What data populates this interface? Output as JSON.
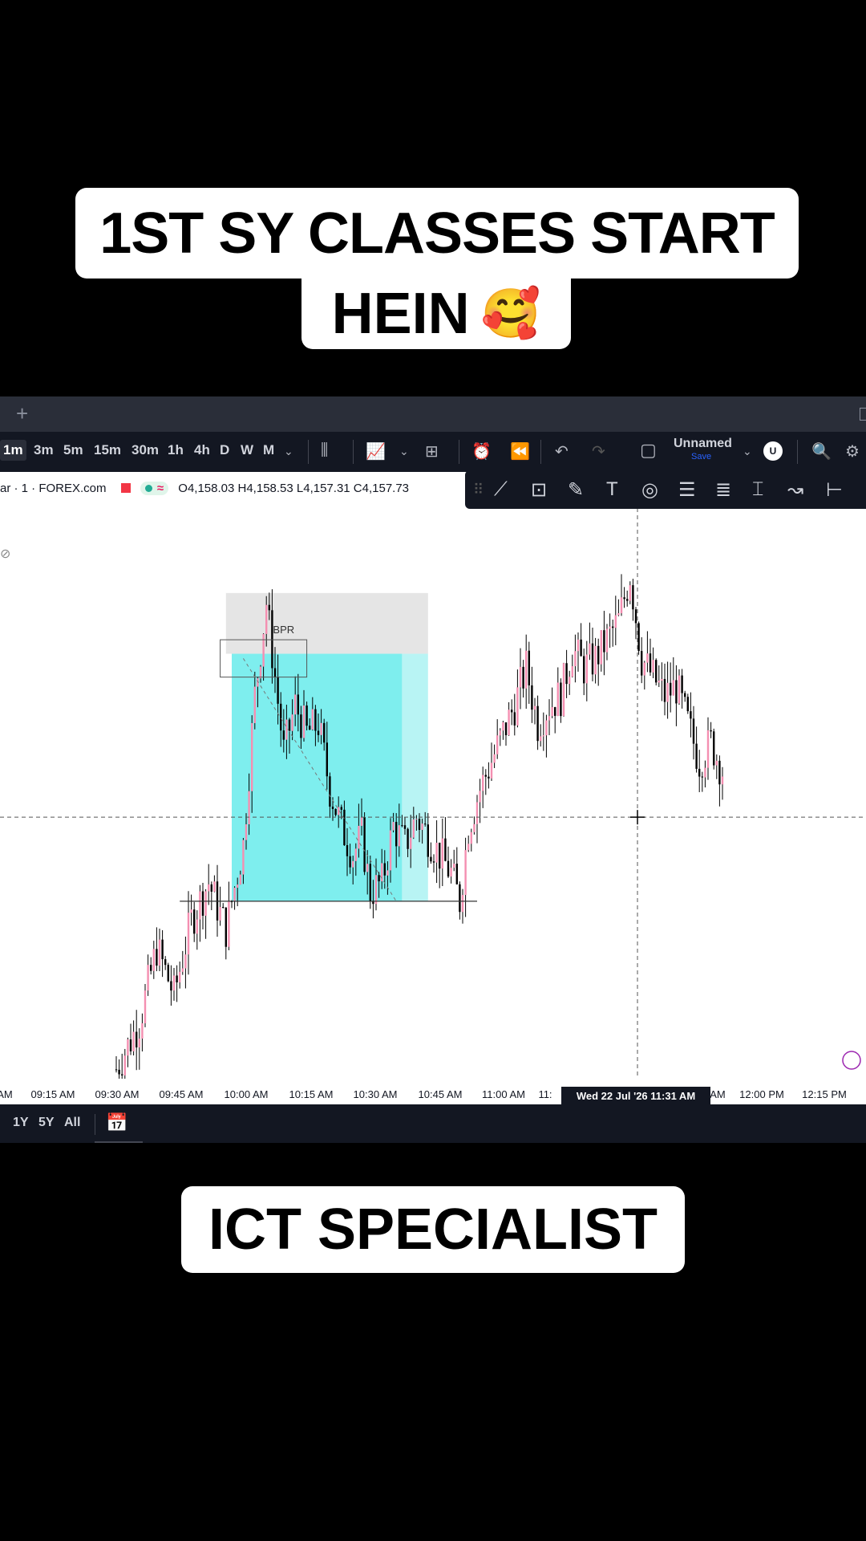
{
  "captions": {
    "top_line1": "1ST SY CLASSES START",
    "top_line2": "HEIN",
    "top_emoji": "🥰",
    "bottom": "ICT SPECIALIST"
  },
  "tabbar": {
    "new_tab": "+"
  },
  "toolbar": {
    "timeframes": [
      "1m",
      "3m",
      "5m",
      "15m",
      "30m",
      "1h",
      "4h",
      "D",
      "W",
      "M"
    ],
    "active_timeframe": "1m",
    "layout_name": "Unnamed",
    "save_label": "Save",
    "avatar": "U"
  },
  "legend": {
    "symbol": "ar · 1 · FOREX.com",
    "wave": "≈",
    "ohlc": "O4,158.03  H4,158.53  L4,157.31  C4,157.73"
  },
  "bottombar": {
    "ranges": [
      "1Y",
      "5Y",
      "All"
    ]
  },
  "colors": {
    "up_candle": "#f48fb1",
    "down_candle": "#000000",
    "box_fill": "#7eeeee",
    "box_light": "#b8f4f4",
    "premium_zone": "#e5e5e5",
    "toolbar_bg": "#131722"
  },
  "chart_data": {
    "type": "candlestick",
    "x_tick_labels": [
      "AM",
      "09:15 AM",
      "09:30 AM",
      "09:45 AM",
      "10:00 AM",
      "10:15 AM",
      "10:30 AM",
      "10:45 AM",
      "11:00 AM",
      "11:",
      "AM",
      "12:00 PM",
      "12:15 PM"
    ],
    "crosshair_label": "Wed 22 Jul '26   11:31 AM",
    "annotations": [
      "BPR"
    ],
    "close_path": [
      [
        0,
        4154.6
      ],
      [
        8,
        4155.1
      ],
      [
        14,
        4155.9
      ],
      [
        20,
        4155.4
      ],
      [
        26,
        4156.2
      ],
      [
        32,
        4156.6
      ],
      [
        38,
        4156.1
      ],
      [
        44,
        4157.0
      ],
      [
        48,
        4158.6
      ],
      [
        52,
        4159.6
      ],
      [
        55,
        4158.8
      ],
      [
        58,
        4158.0
      ],
      [
        62,
        4158.5
      ],
      [
        66,
        4158.2
      ],
      [
        70,
        4158.3
      ],
      [
        74,
        4157.6
      ],
      [
        78,
        4157.2
      ],
      [
        82,
        4156.9
      ],
      [
        85,
        4157.1
      ],
      [
        88,
        4156.5
      ],
      [
        92,
        4156.6
      ],
      [
        96,
        4157.2
      ],
      [
        100,
        4157.0
      ],
      [
        104,
        4157.3
      ],
      [
        108,
        4157.1
      ],
      [
        112,
        4156.9
      ],
      [
        116,
        4156.7
      ],
      [
        119,
        4156.4
      ],
      [
        122,
        4157.2
      ],
      [
        126,
        4157.6
      ],
      [
        130,
        4157.9
      ],
      [
        134,
        4158.2
      ],
      [
        138,
        4158.5
      ],
      [
        142,
        4158.9
      ],
      [
        146,
        4158.3
      ],
      [
        150,
        4158.5
      ],
      [
        154,
        4158.6
      ],
      [
        158,
        4159.1
      ],
      [
        162,
        4158.9
      ],
      [
        166,
        4159.0
      ],
      [
        170,
        4159.2
      ],
      [
        174,
        4159.4
      ],
      [
        178,
        4159.9
      ],
      [
        182,
        4159.0
      ],
      [
        186,
        4158.8
      ],
      [
        190,
        4158.6
      ],
      [
        194,
        4158.7
      ],
      [
        198,
        4158.3
      ],
      [
        202,
        4157.9
      ],
      [
        206,
        4158.1
      ],
      [
        210,
        4157.8
      ]
    ]
  }
}
